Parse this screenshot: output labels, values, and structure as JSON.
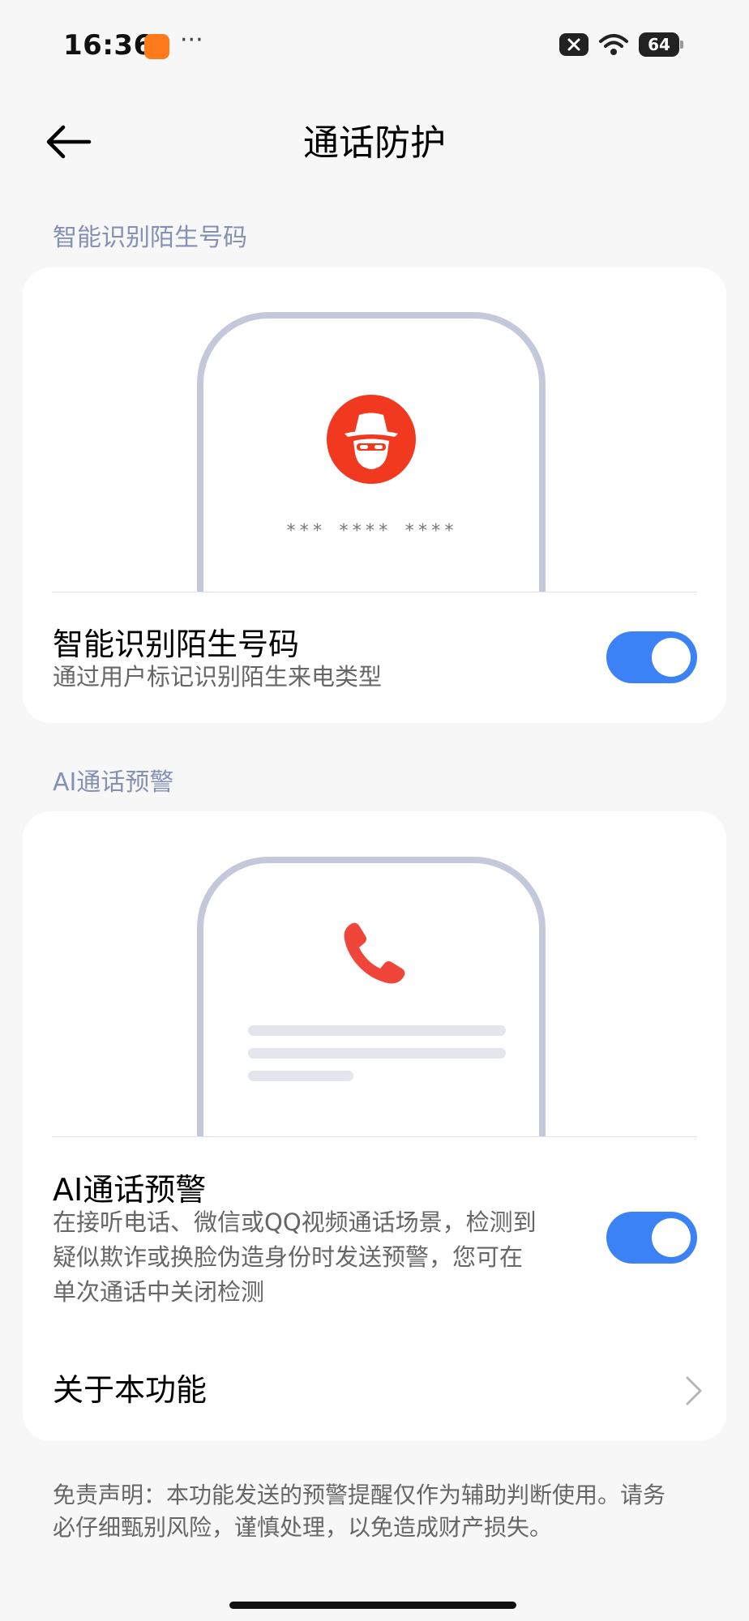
{
  "status_bar": {
    "time": "16:36",
    "more": "···",
    "battery": "64",
    "icons": [
      "shop-app-icon",
      "close-icon",
      "wifi-icon",
      "battery-icon"
    ]
  },
  "header": {
    "title": "通话防护",
    "back_icon": "arrow-left-icon"
  },
  "section1": {
    "label": "智能识别陌生号码",
    "illustration": {
      "icon": "incognito-spy-icon",
      "masked_number": "*** **** ****"
    },
    "row": {
      "title": "智能识别陌生号码",
      "subtitle": "通过用户标记识别陌生来电类型",
      "toggle_on": true
    }
  },
  "section2": {
    "label": "AI通话预警",
    "illustration": {
      "icon": "phone-handset-icon"
    },
    "row": {
      "title": "AI通话预警",
      "subtitle_lines": [
        "在接听电话、微信或QQ视频通话场景，检测到",
        "疑似欺诈或换脸伪造身份时发送预警，您可在",
        "单次通话中关闭检测"
      ],
      "toggle_on": true
    },
    "about": {
      "label": "关于本功能",
      "icon": "chevron-right-icon"
    }
  },
  "disclaimer": {
    "lines": [
      "免责声明：本功能发送的预警提醒仅作为辅助判断使用。请务",
      "必仔细甄别风险，谨慎处理，以免造成财产损失。"
    ]
  },
  "colors": {
    "accent": "#3b82f6",
    "alert_red": "#f0391f",
    "section_label": "#8591b3",
    "phone_frame": "#c3c8da"
  }
}
